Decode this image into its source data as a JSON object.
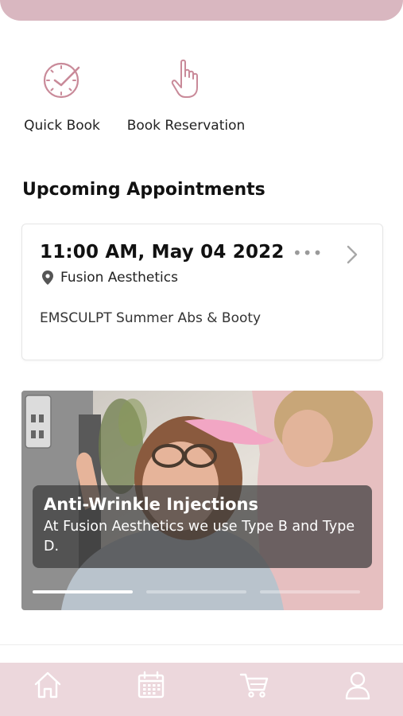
{
  "quick_actions": [
    {
      "label": "Quick Book",
      "icon": "clock-check-icon"
    },
    {
      "label": "Book Reservation",
      "icon": "pointer-hand-icon"
    }
  ],
  "section": {
    "title": "Upcoming Appointments"
  },
  "appointment": {
    "datetime": "11:00 AM, May 04 2022",
    "location": "Fusion Aesthetics",
    "service": "EMSCULPT Summer Abs & Booty",
    "more": "•••"
  },
  "promo": {
    "title": "Anti-Wrinkle Injections",
    "description": "At Fusion Aesthetics we use Type B and Type D.",
    "slides_total": 3,
    "active_slide": 1
  },
  "bottom_nav": [
    {
      "icon": "home-icon"
    },
    {
      "icon": "calendar-icon"
    },
    {
      "icon": "cart-icon"
    },
    {
      "icon": "profile-icon"
    }
  ],
  "colors": {
    "accent": "#c98a99",
    "banner": "#d9b7c0",
    "nav_bg": "#ecd7dc",
    "nav_icon": "#ffffff"
  }
}
